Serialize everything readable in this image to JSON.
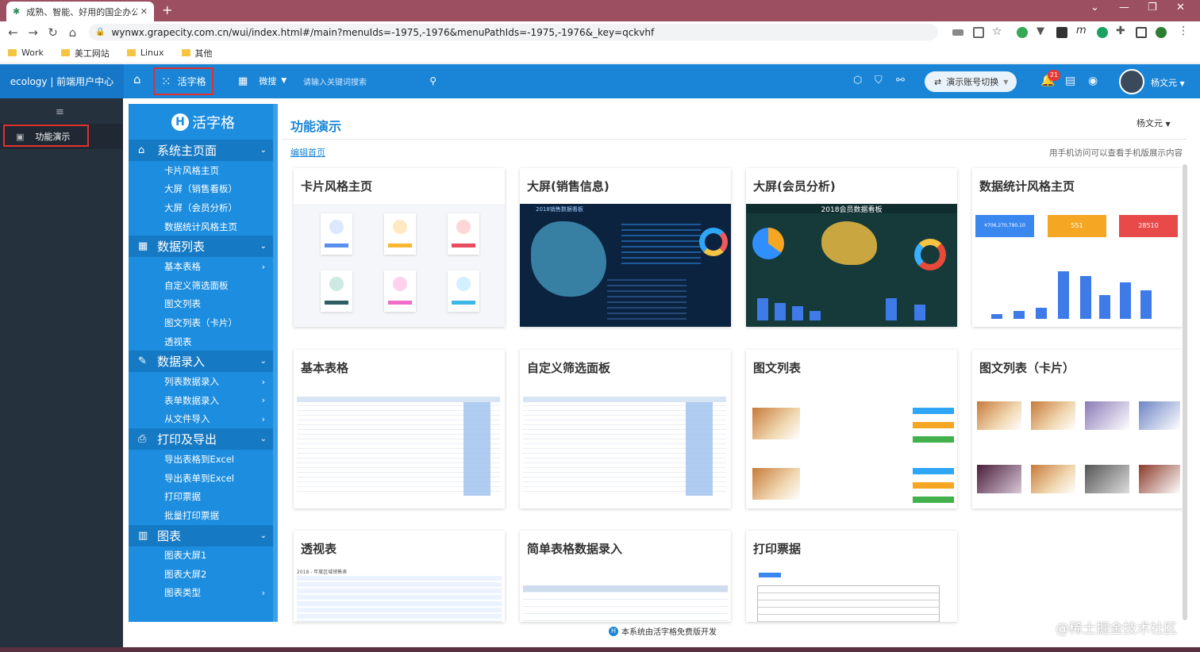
{
  "browser": {
    "tab_title": "成熟、智能、好用的国企办公平",
    "url": "wynwx.grapecity.com.cn/wui/index.html#/main?menuIds=-1975,-1976&menuPathIds=-1975,-1976&_key=qckvhf",
    "bookmarks": [
      "Work",
      "美工网站",
      "Linux",
      "其他"
    ]
  },
  "header": {
    "brand": "ecology | 前端用户中心",
    "active_app": "活字格",
    "workspace_menu": "微搜",
    "search_placeholder": "请输入关键词搜索",
    "account_switch": "演示账号切换",
    "notification_count": "21",
    "user_name": "杨文元"
  },
  "leftnav": {
    "item": "功能演示"
  },
  "sidebar": {
    "brand": "活字格",
    "groups": [
      {
        "label": "系统主页面",
        "items": [
          "卡片风格主页",
          "大屏（销售看板）",
          "大屏（会员分析）",
          "数据统计风格主页"
        ]
      },
      {
        "label": "数据列表",
        "items": [
          "基本表格",
          "自定义筛选面板",
          "图文列表",
          "图文列表（卡片）",
          "透视表"
        ]
      },
      {
        "label": "数据录入",
        "items": [
          "列表数据录入",
          "表单数据录入",
          "从文件导入"
        ]
      },
      {
        "label": "打印及导出",
        "items": [
          "导出表格到Excel",
          "导出表单到Excel",
          "打印票据",
          "批量打印票据"
        ]
      },
      {
        "label": "图表",
        "items": [
          "图表大屏1",
          "图表大屏2",
          "图表类型"
        ]
      }
    ]
  },
  "content": {
    "title": "功能演示",
    "user": "杨文元",
    "edit_link": "编辑首页",
    "mobile_hint": "用手机访问可以查看手机版展示内容",
    "cards": [
      "卡片风格主页",
      "大屏(销售信息)",
      "大屏(会员分析)",
      "数据统计风格主页",
      "基本表格",
      "自定义筛选面板",
      "图文列表",
      "图文列表（卡片）",
      "透视表",
      "简单表格数据录入",
      "打印票据"
    ],
    "thumb_texts": {
      "sales_board_title": "2018销售数据看板",
      "member_board_title": "2018会员数据看板",
      "stat_values": [
        "¥706,270,790.10",
        "551",
        "28510"
      ],
      "pivot_caption": "2018 - 年度区域销售表"
    },
    "footer": "本系统由活字格免费版开发"
  },
  "watermark": "@稀土掘金技术社区",
  "colors": {
    "brand_blue": "#1a85d6",
    "sidebar_blue": "#1c8ddf",
    "highlight_red": "#e0322f",
    "dark_nav": "#26313e"
  }
}
